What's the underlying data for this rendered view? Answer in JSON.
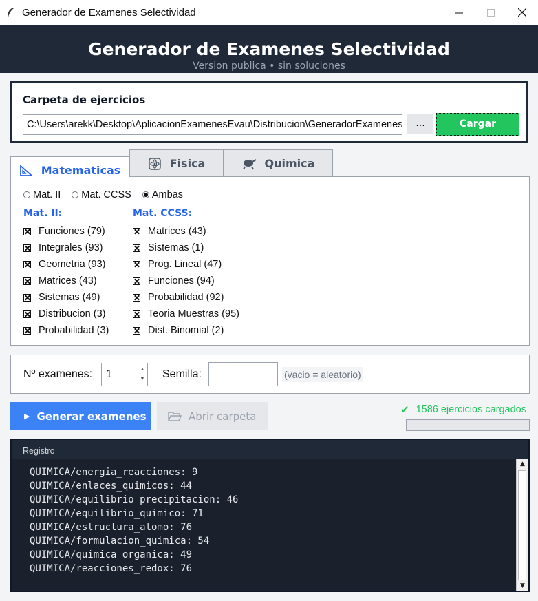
{
  "window": {
    "title": "Generador de Examenes Selectividad",
    "icons": [
      "feather-icon",
      "minimize-icon",
      "maximize-icon",
      "close-icon"
    ]
  },
  "header": {
    "title": "Generador de Examenes Selectividad",
    "subtitle": "Version publica  •  sin soluciones"
  },
  "folder": {
    "label": "Carpeta de ejercicios",
    "path": "C:\\Users\\arekk\\Desktop\\AplicacionExamenesEvau\\Distribucion\\GeneradorExamenes",
    "browse_label": "...",
    "load_label": "Cargar"
  },
  "tabs": [
    {
      "label": "Matematicas",
      "icon": "set-square-icon",
      "active": true
    },
    {
      "label": "Fisica",
      "icon": "atom-icon",
      "active": false
    },
    {
      "label": "Quimica",
      "icon": "chemistry-flask-icon",
      "active": false
    }
  ],
  "radios": [
    {
      "label": "Mat. II",
      "selected": false
    },
    {
      "label": "Mat. CCSS",
      "selected": false
    },
    {
      "label": "Ambas",
      "selected": true
    }
  ],
  "mat2": {
    "title": "Mat. II:",
    "items": [
      "Funciones (79)",
      "Integrales (93)",
      "Geometria (93)",
      "Matrices (43)",
      "Sistemas (49)",
      "Distribucion (3)",
      "Probabilidad (3)"
    ]
  },
  "ccss": {
    "title": "Mat. CCSS:",
    "items": [
      "Matrices (43)",
      "Sistemas (1)",
      "Prog. Lineal (47)",
      "Funciones (94)",
      "Probabilidad (92)",
      "Teoria Muestras (95)",
      "Dist. Binomial (2)"
    ]
  },
  "options": {
    "num_label": "Nº examenes:",
    "num_value": "1",
    "seed_label": "Semilla:",
    "seed_value": "",
    "seed_hint": "(vacio = aleatorio)"
  },
  "actions": {
    "generate_label": "Generar examenes",
    "open_label": "Abrir carpeta",
    "status": "1586 ejercicios cargados",
    "progress": 0
  },
  "log": {
    "title": "Registro",
    "lines": [
      "QUIMICA/energia_reacciones: 9",
      "QUIMICA/enlaces_quimicos: 44",
      "QUIMICA/equilibrio_precipitacion: 46",
      "QUIMICA/equilibrio_quimico: 71",
      "QUIMICA/estructura_atomo: 76",
      "QUIMICA/formulacion_quimica: 54",
      "QUIMICA/quimica_organica: 49",
      "QUIMICA/reacciones_redox: 76"
    ]
  },
  "colors": {
    "accent": "#2563eb",
    "success": "#22c55e",
    "header": "#1f2937"
  }
}
